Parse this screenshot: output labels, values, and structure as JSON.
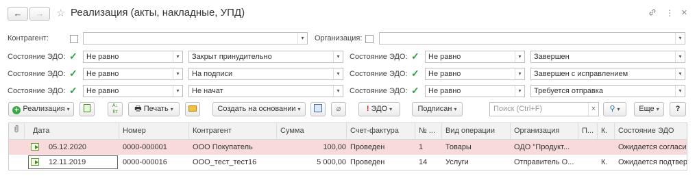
{
  "window": {
    "title": "Реализация (акты, накладные, УПД)",
    "back": "←",
    "forward": "→",
    "star": "☆",
    "link_icon": "🔗",
    "menu_icon": "⋮",
    "close_icon": "×"
  },
  "filters": {
    "counterparty_label": "Контрагент:",
    "counterparty_value": "",
    "org_label": "Организация:",
    "org_value": "",
    "edo_label": "Состояние ЭДО:",
    "rows": [
      {
        "cond_left": "Не равно",
        "val_left": "Закрыт принудительно",
        "cond_right": "Не равно",
        "val_right": "Завершен"
      },
      {
        "cond_left": "Не равно",
        "val_left": "На подписи",
        "cond_right": "Не равно",
        "val_right": "Завершен с исправлением"
      },
      {
        "cond_left": "Не равно",
        "val_left": "Не начат",
        "cond_right": "Не равно",
        "val_right": "Требуется отправка"
      }
    ]
  },
  "toolbar": {
    "realization": "Реализация",
    "print": "Печать",
    "create_based": "Создать на основании",
    "edo": "ЭДО",
    "signed": "Подписан",
    "search_placeholder": "Поиск (Ctrl+F)",
    "search_clear": "×",
    "more": "Еще",
    "help": "?"
  },
  "table": {
    "columns": [
      "Дата",
      "Номер",
      "Контрагент",
      "Сумма",
      "Счет-фактура",
      "№ ...",
      "Вид операции",
      "Организация",
      "П...",
      "К.",
      "Состояние ЭДО"
    ],
    "rows": [
      {
        "date": "05.12.2020",
        "number": "0000-000001",
        "counterparty": "ООО Покупатель",
        "sum": "100,00",
        "invoice": "Проведен",
        "num": "1",
        "operation": "Товары",
        "org": "ОДО \"Продукт...",
        "p": "",
        "k": "",
        "edo_state": "Ожидается согласие"
      },
      {
        "date": "12.11.2019",
        "number": "0000-000016",
        "counterparty": "ООО_тест_тест16",
        "sum": "5 000,00",
        "invoice": "Проведен",
        "num": "14",
        "operation": "Услуги",
        "org": "Отправитель О...",
        "p": "",
        "k": "К.",
        "edo_state": "Ожидается подтверж"
      }
    ]
  },
  "colors": {
    "row_highlight": "#f9dada",
    "check_green": "#2e9e3c",
    "doc_green": "#3f8a1d"
  }
}
